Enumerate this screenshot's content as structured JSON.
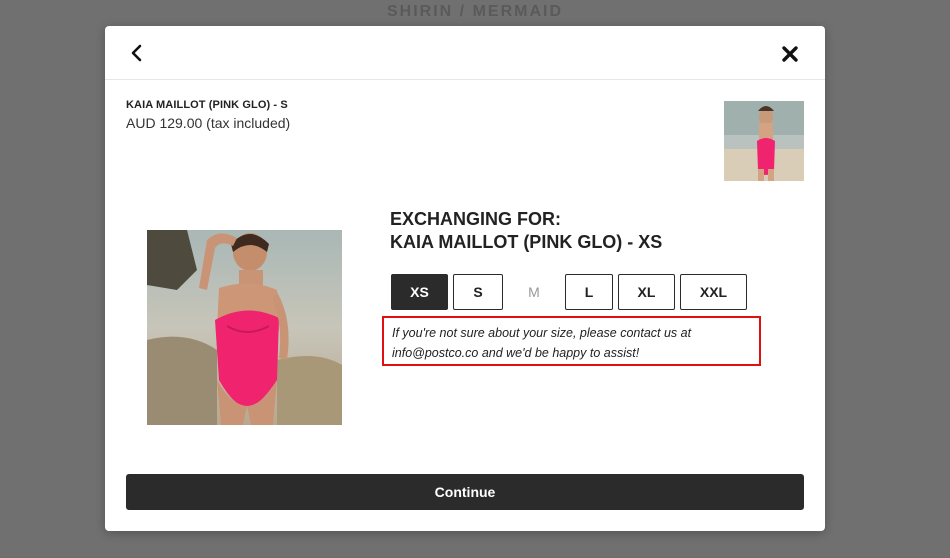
{
  "backdrop": {
    "title": "SHIRIN / MERMAID"
  },
  "modal": {
    "original_item": {
      "name": "KAIA MAILLOT (PINK GLO) - S",
      "price": "AUD 129.00 (tax included)"
    },
    "exchange": {
      "heading_line1": "EXCHANGING FOR:",
      "heading_line2": "KAIA MAILLOT (PINK GLO) - XS"
    },
    "sizes": [
      {
        "label": "XS",
        "state": "selected"
      },
      {
        "label": "S",
        "state": "available"
      },
      {
        "label": "M",
        "state": "unavailable"
      },
      {
        "label": "L",
        "state": "available"
      },
      {
        "label": "XL",
        "state": "available"
      },
      {
        "label": "XXL",
        "state": "available"
      }
    ],
    "note": "If you're not sure about your size, please contact us at info@postco.co and we'd be happy to assist!",
    "continue_label": "Continue"
  },
  "colors": {
    "dark": "#2b2b2b",
    "highlight": "#e01010",
    "swimsuit": "#f0246e"
  },
  "icons": {
    "back": "chevron-left-icon",
    "close": "close-icon"
  }
}
